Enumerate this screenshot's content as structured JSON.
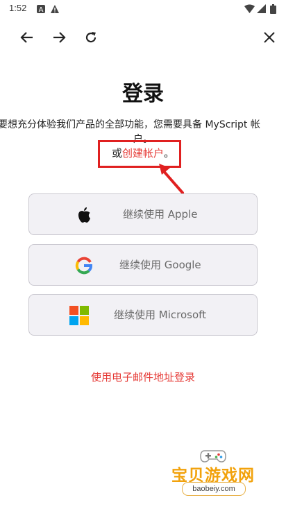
{
  "status_bar": {
    "time": "1:52",
    "left_icons": [
      "notification-a-icon",
      "warning-icon"
    ],
    "right_icons": [
      "wifi-icon",
      "cell-signal-icon",
      "battery-icon"
    ]
  },
  "nav": {
    "icons": [
      "back-arrow-icon",
      "forward-arrow-icon",
      "reload-icon",
      "close-icon"
    ]
  },
  "page": {
    "title": "登录",
    "description_line1": "要想充分体验我们产品的全部功能，您需要具备 MyScript 帐",
    "description_line2": "户。",
    "or_text": "或",
    "create_account_link": "创建帐户",
    "period": "。"
  },
  "sso_buttons": [
    {
      "label": "继续使用 Apple",
      "icon": "apple-logo-icon"
    },
    {
      "label": "继续使用 Google",
      "icon": "google-logo-icon"
    },
    {
      "label": "继续使用 Microsoft",
      "icon": "microsoft-logo-icon"
    }
  ],
  "email_login_link": "使用电子邮件地址登录",
  "watermark": {
    "title": "宝贝游戏网",
    "url": "baobeiy.com"
  },
  "colors": {
    "link_red": "#e53935",
    "annotation_red": "#e02020",
    "button_bg": "#f2f1f5"
  }
}
